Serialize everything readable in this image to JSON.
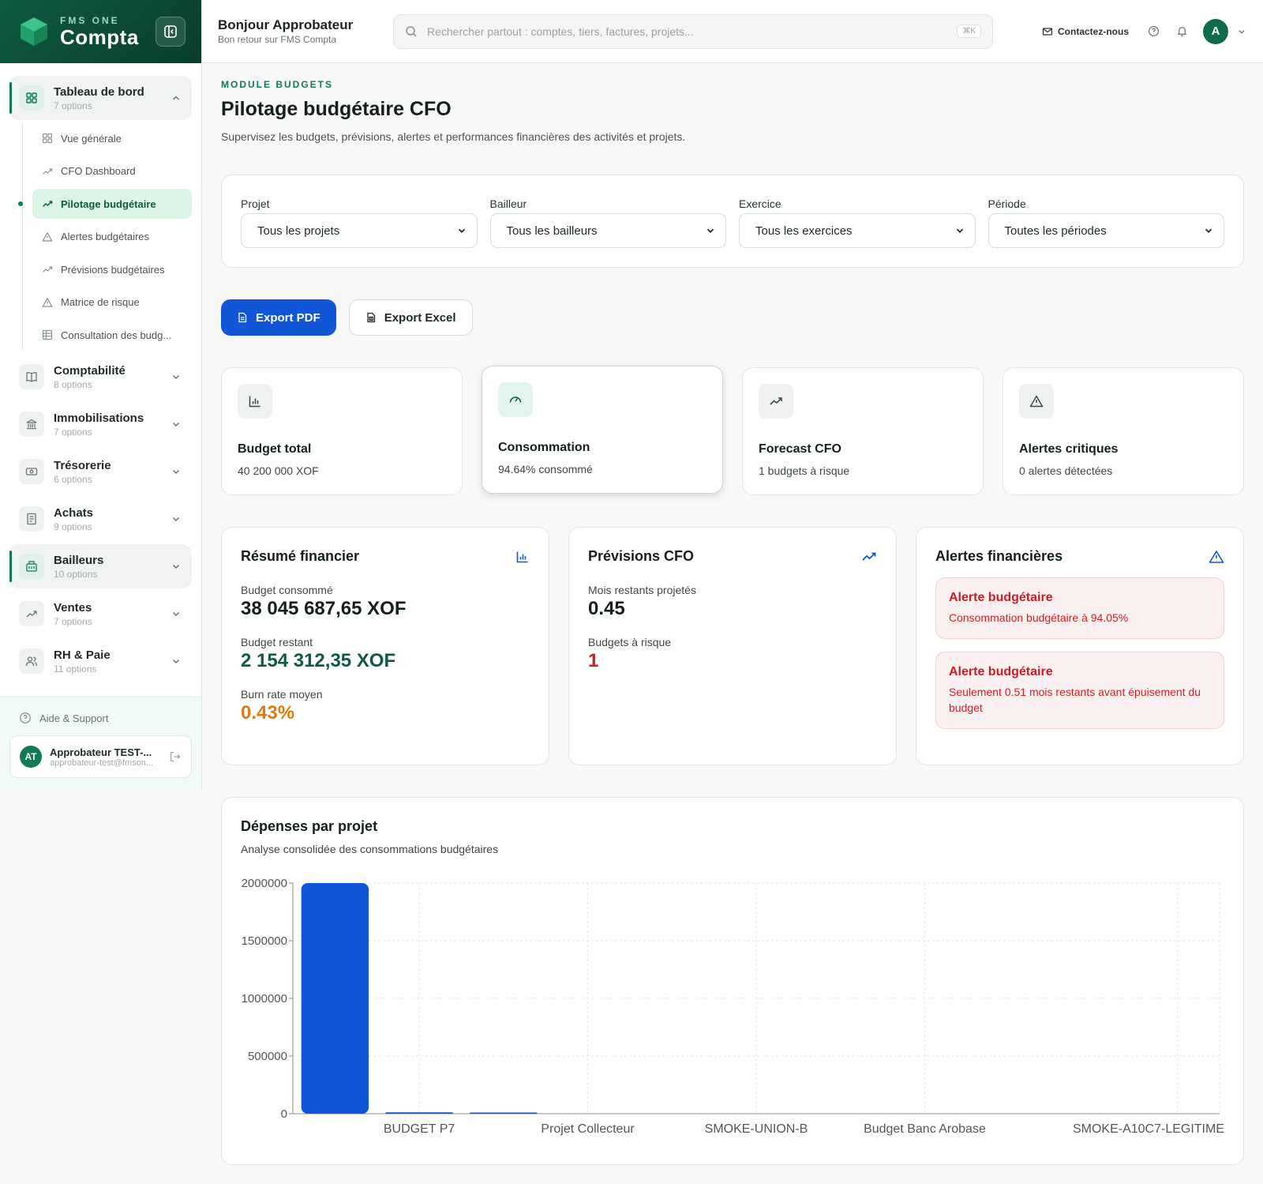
{
  "brand": {
    "small": "FMS ONE",
    "big": "Compta"
  },
  "topbar": {
    "greeting": "Bonjour Approbateur",
    "subtitle": "Bon retour sur FMS Compta",
    "search_placeholder": "Rechercher partout : comptes, tiers, factures, projets...",
    "search_shortcut": "⌘K",
    "contact": "Contactez-nous",
    "avatar_initial": "A"
  },
  "sidebar": {
    "groups": [
      {
        "label": "Tableau de bord",
        "sub": "7 options",
        "icon": "grid-icon",
        "expanded": true
      },
      {
        "label": "Comptabilité",
        "sub": "8 options",
        "icon": "book-icon"
      },
      {
        "label": "Immobilisations",
        "sub": "7 options",
        "icon": "bank-icon"
      },
      {
        "label": "Trésorerie",
        "sub": "6 options",
        "icon": "banknote-icon"
      },
      {
        "label": "Achats",
        "sub": "9 options",
        "icon": "receipt-icon"
      },
      {
        "label": "Bailleurs",
        "sub": "10 options",
        "icon": "building-icon",
        "active": true
      },
      {
        "label": "Ventes",
        "sub": "7 options",
        "icon": "trend-icon"
      },
      {
        "label": "RH & Paie",
        "sub": "11 options",
        "icon": "users-icon"
      }
    ],
    "sub_items": [
      {
        "label": "Vue générale",
        "icon": "grid-icon"
      },
      {
        "label": "CFO Dashboard",
        "icon": "trend-icon"
      },
      {
        "label": "Pilotage budgétaire",
        "icon": "trend-icon",
        "active": true
      },
      {
        "label": "Alertes budgétaires",
        "icon": "warning-icon"
      },
      {
        "label": "Prévisions budgétaires",
        "icon": "trend-icon"
      },
      {
        "label": "Matrice de risque",
        "icon": "warning-icon"
      },
      {
        "label": "Consultation des budg...",
        "icon": "table-icon"
      }
    ],
    "help": "Aide & Support",
    "user": {
      "initials": "AT",
      "name": "Approbateur TEST-...",
      "email": "approbateur-test@fmson..."
    }
  },
  "page": {
    "eyebrow": "MODULE BUDGETS",
    "title": "Pilotage budgétaire CFO",
    "description": "Supervisez les budgets, prévisions, alertes et performances financières des activités et projets."
  },
  "filters": [
    {
      "label": "Projet",
      "value": "Tous les projets"
    },
    {
      "label": "Bailleur",
      "value": "Tous les bailleurs"
    },
    {
      "label": "Exercice",
      "value": "Tous les exercices"
    },
    {
      "label": "Période",
      "value": "Toutes les périodes"
    }
  ],
  "actions": {
    "export_pdf": "Export PDF",
    "export_excel": "Export Excel"
  },
  "kpis": [
    {
      "title": "Budget total",
      "value": "40 200 000 XOF",
      "icon": "bar-chart-icon"
    },
    {
      "title": "Consommation",
      "value": "94.64% consommé",
      "icon": "gauge-icon"
    },
    {
      "title": "Forecast CFO",
      "value": "1 budgets à risque",
      "icon": "trend-icon"
    },
    {
      "title": "Alertes critiques",
      "value": "0 alertes détectées",
      "icon": "warning-icon"
    }
  ],
  "summary": {
    "title": "Résumé financier",
    "consumed_label": "Budget consommé",
    "consumed_value": "38 045 687,65 XOF",
    "remaining_label": "Budget restant",
    "remaining_value": "2 154 312,35 XOF",
    "burn_label": "Burn rate moyen",
    "burn_value": "0.43%"
  },
  "forecast": {
    "title": "Prévisions CFO",
    "months_label": "Mois restants projetés",
    "months_value": "0.45",
    "risk_label": "Budgets à risque",
    "risk_value": "1"
  },
  "alerts": {
    "title": "Alertes financières",
    "items": [
      {
        "title": "Alerte budgétaire",
        "text": "Consommation budgétaire à 94.05%"
      },
      {
        "title": "Alerte budgétaire",
        "text": "Seulement 0.51 mois restants avant épuisement du budget"
      }
    ]
  },
  "colors": {
    "brand_green": "#0f5a41",
    "accent_blue": "#1256d8",
    "danger_red": "#d11f26",
    "warning_orange": "#e07b12"
  },
  "chart": {
    "title": "Dépenses par projet",
    "subtitle": "Analyse consolidée des consommations budgétaires"
  },
  "chart_data": {
    "type": "bar",
    "categories": [
      "",
      "BUDGET P7",
      "",
      "Projet Collecteur",
      "",
      "SMOKE-UNION-B",
      "",
      "Budget Banc Arobase",
      "",
      "",
      "SMOKE-A10C7-LEGITIME"
    ],
    "values": [
      2000000,
      12000,
      8000,
      0,
      0,
      0,
      0,
      0,
      0,
      0,
      0
    ],
    "y_ticks": [
      0,
      500000,
      1000000,
      1500000,
      2000000
    ],
    "ylim": [
      0,
      2000000
    ],
    "grid": true,
    "bar_color": "#1256d8"
  }
}
